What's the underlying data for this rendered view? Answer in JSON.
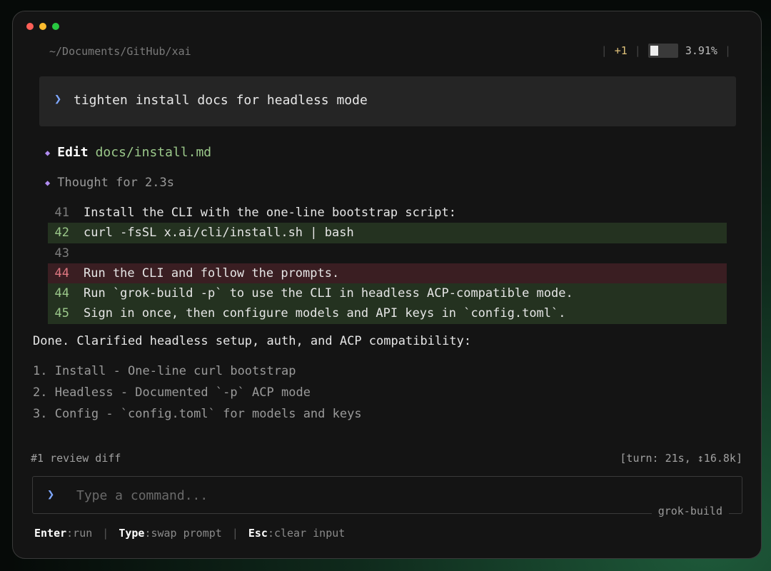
{
  "window": {
    "path": "~/Documents/GitHub/xai",
    "status": {
      "changes": "+1",
      "context_fill": 0.0391,
      "context_pct": "3.91%"
    }
  },
  "prompt": {
    "text": "tighten install docs for headless mode"
  },
  "edit": {
    "label": "Edit",
    "file": "docs/install.md"
  },
  "thought": {
    "text": "Thought for 2.3s"
  },
  "diff": {
    "lines": [
      {
        "num": "41",
        "type": "context",
        "text": "Install the CLI with the one-line bootstrap script:"
      },
      {
        "num": "42",
        "type": "add",
        "text": "curl -fsSL x.ai/cli/install.sh | bash"
      },
      {
        "num": "43",
        "type": "context",
        "text": ""
      },
      {
        "num": "44",
        "type": "del",
        "text": "Run the CLI and follow the prompts."
      },
      {
        "num": "44",
        "type": "add",
        "text": "Run `grok-build -p` to use the CLI in headless ACP-compatible mode."
      },
      {
        "num": "45",
        "type": "add",
        "text": "Sign in once, then configure models and API keys in `config.toml`."
      }
    ]
  },
  "summary": {
    "text": "Done. Clarified headless setup, auth, and ACP compatibility:"
  },
  "list": [
    "1. Install - One-line curl bootstrap",
    "2. Headless - Documented `-p` ACP mode",
    "3. Config - `config.toml` for models and keys"
  ],
  "footer": {
    "review": "#1 review diff",
    "turn": "[turn: 21s, ↕16.8k]"
  },
  "input": {
    "placeholder": "Type a command...",
    "mode": "grok-build"
  },
  "hints": [
    {
      "key": "Enter",
      "action": ":run"
    },
    {
      "key": "Type",
      "action": ":swap prompt"
    },
    {
      "key": "Esc",
      "action": ":clear input"
    }
  ],
  "colors": {
    "accent_blue": "#7fa8ff",
    "diamond_purple": "#b18cf0",
    "add_green": "#9bc88a",
    "del_red": "#e07882",
    "changes_gold": "#e0c27a"
  },
  "icons": {
    "prompt": "chevron-right-icon",
    "edit_marker": "diamond-icon",
    "thought_marker": "diamond-icon",
    "input": "chevron-right-icon"
  }
}
